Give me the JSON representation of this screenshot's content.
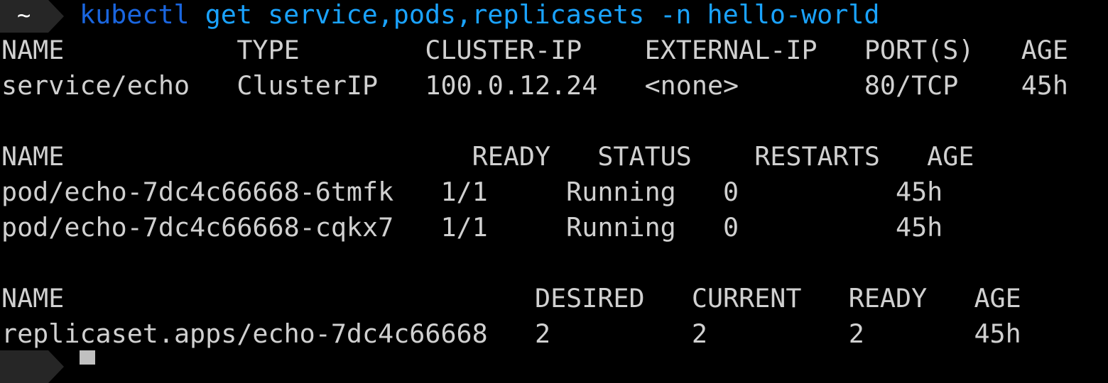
{
  "prompt": {
    "cwd": "~"
  },
  "command": {
    "program": "kubectl",
    "args": "get service,pods,replicasets -n hello-world"
  },
  "output": {
    "services": {
      "header": "NAME           TYPE        CLUSTER-IP    EXTERNAL-IP   PORT(S)   AGE",
      "rows": [
        "service/echo   ClusterIP   100.0.12.24   <none>        80/TCP    45h"
      ]
    },
    "pods": {
      "header": "NAME                          READY   STATUS    RESTARTS   AGE",
      "rows": [
        "pod/echo-7dc4c66668-6tmfk   1/1     Running   0          45h",
        "pod/echo-7dc4c66668-cqkx7   1/1     Running   0          45h"
      ]
    },
    "replicasets": {
      "header": "NAME                              DESIRED   CURRENT   READY   AGE",
      "rows": [
        "replicaset.apps/echo-7dc4c66668   2         2         2       45h"
      ]
    }
  }
}
